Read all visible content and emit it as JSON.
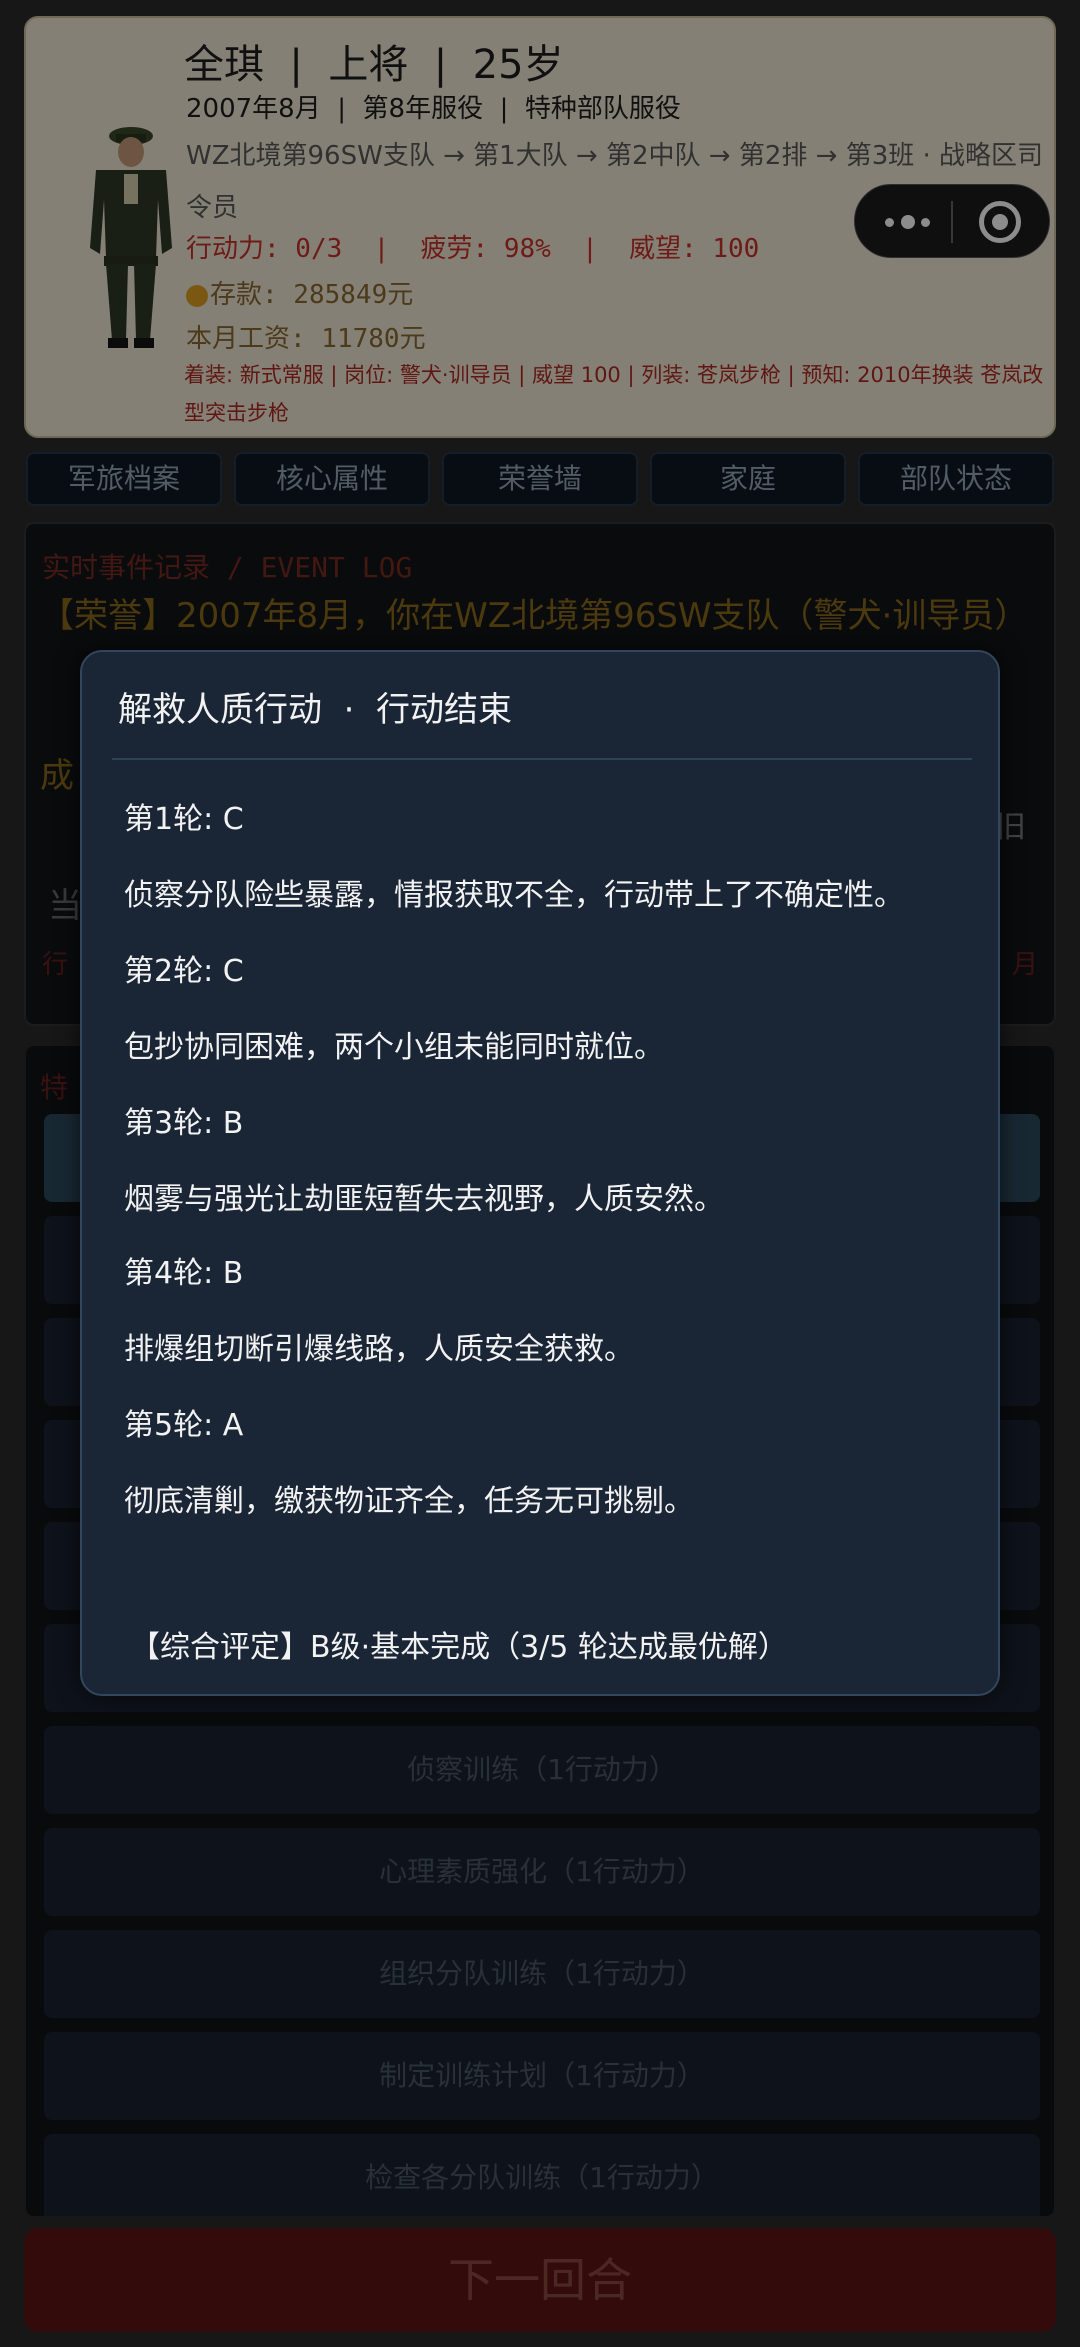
{
  "profile": {
    "title": "全琪  |  上将  |  25岁",
    "subtitle": "2007年8月  |  第8年服役  |  特种部队服役",
    "unit_chain": "WZ北境第96SW支队 → 第1大队 → 第2中队 → 第2排 → 第3班 · 战略区司令员",
    "stats": "行动力: 0/3  |  疲劳: 98%  |  威望: 100",
    "savings": "存款: 285849元",
    "salary": "本月工资: 11780元",
    "equipment": "着装: 新式常服 | 岗位: 警犬·训导员 | 威望 100 | 列装: 苍岚步枪 | 预知: 2010年换装 苍岚改型突击步枪"
  },
  "tabs": [
    {
      "label": "军旅档案"
    },
    {
      "label": "核心属性"
    },
    {
      "label": "荣誉墙"
    },
    {
      "label": "家庭"
    },
    {
      "label": "部队状态"
    }
  ],
  "event_log": {
    "label": "实时事件记录 / EVENT LOG",
    "text": "【荣誉】2007年8月，你在WZ北境第96SW支队（警犬·训导员）",
    "line3": "成",
    "tail": "旧",
    "now": "当",
    "red_prefix": "行",
    "red_suffix": "月"
  },
  "actions": {
    "label": "特",
    "items": [
      {
        "label": ""
      },
      {
        "label": ""
      },
      {
        "label": ""
      },
      {
        "label": ""
      },
      {
        "label": ""
      },
      {
        "label": ""
      },
      {
        "label": "侦察训练（1行动力）"
      },
      {
        "label": "心理素质强化（1行动力）"
      },
      {
        "label": "组织分队训练（1行动力）"
      },
      {
        "label": "制定训练计划（1行动力）"
      },
      {
        "label": "检查各分队训练（1行动力）"
      }
    ]
  },
  "next_turn": "下一回合",
  "modal": {
    "title": "解救人质行动  ·  行动结束",
    "rounds": [
      {
        "label": "第1轮: C",
        "desc": "侦察分队险些暴露，情报获取不全，行动带上了不确定性。"
      },
      {
        "label": "第2轮: C",
        "desc": "包抄协同困难，两个小组未能同时就位。"
      },
      {
        "label": "第3轮: B",
        "desc": "烟雾与强光让劫匪短暂失去视野，人质安然。"
      },
      {
        "label": "第4轮: B",
        "desc": "排爆组切断引爆线路，人质安全获救。"
      },
      {
        "label": "第5轮: A",
        "desc": "彻底清剿，缴获物证齐全，任务无可挑剔。"
      }
    ],
    "summary": "【综合评定】B级·基本完成（3/5 轮达成最优解）"
  }
}
